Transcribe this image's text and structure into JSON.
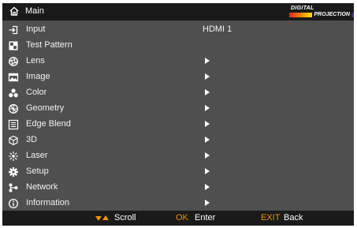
{
  "header": {
    "title": "Main",
    "icon": "home-icon",
    "logo_line1": "DIGITAL",
    "logo_line2": "PROJECTION"
  },
  "menu": {
    "items": [
      {
        "label": "Input",
        "icon": "input-icon",
        "value": "HDMI 1"
      },
      {
        "label": "Test Pattern",
        "icon": "test-pattern-icon"
      },
      {
        "label": "Lens",
        "icon": "lens-icon",
        "submenu": true
      },
      {
        "label": "Image",
        "icon": "image-icon",
        "submenu": true
      },
      {
        "label": "Color",
        "icon": "color-icon",
        "submenu": true
      },
      {
        "label": "Geometry",
        "icon": "geometry-icon",
        "submenu": true
      },
      {
        "label": "Edge Blend",
        "icon": "edge-blend-icon",
        "submenu": true
      },
      {
        "label": "3D",
        "icon": "3d-icon",
        "submenu": true
      },
      {
        "label": "Laser",
        "icon": "laser-icon",
        "submenu": true
      },
      {
        "label": "Setup",
        "icon": "setup-icon",
        "submenu": true
      },
      {
        "label": "Network",
        "icon": "network-icon",
        "submenu": true
      },
      {
        "label": "Information",
        "icon": "information-icon",
        "submenu": true
      }
    ]
  },
  "footer": {
    "scroll": "Scroll",
    "ok": "OK",
    "enter": "Enter",
    "exit": "EXIT",
    "back": "Back"
  },
  "colors": {
    "background": "#4f4f4f",
    "bar": "#1a1a1a",
    "accent": "#f39200",
    "text": "#ffffff"
  }
}
